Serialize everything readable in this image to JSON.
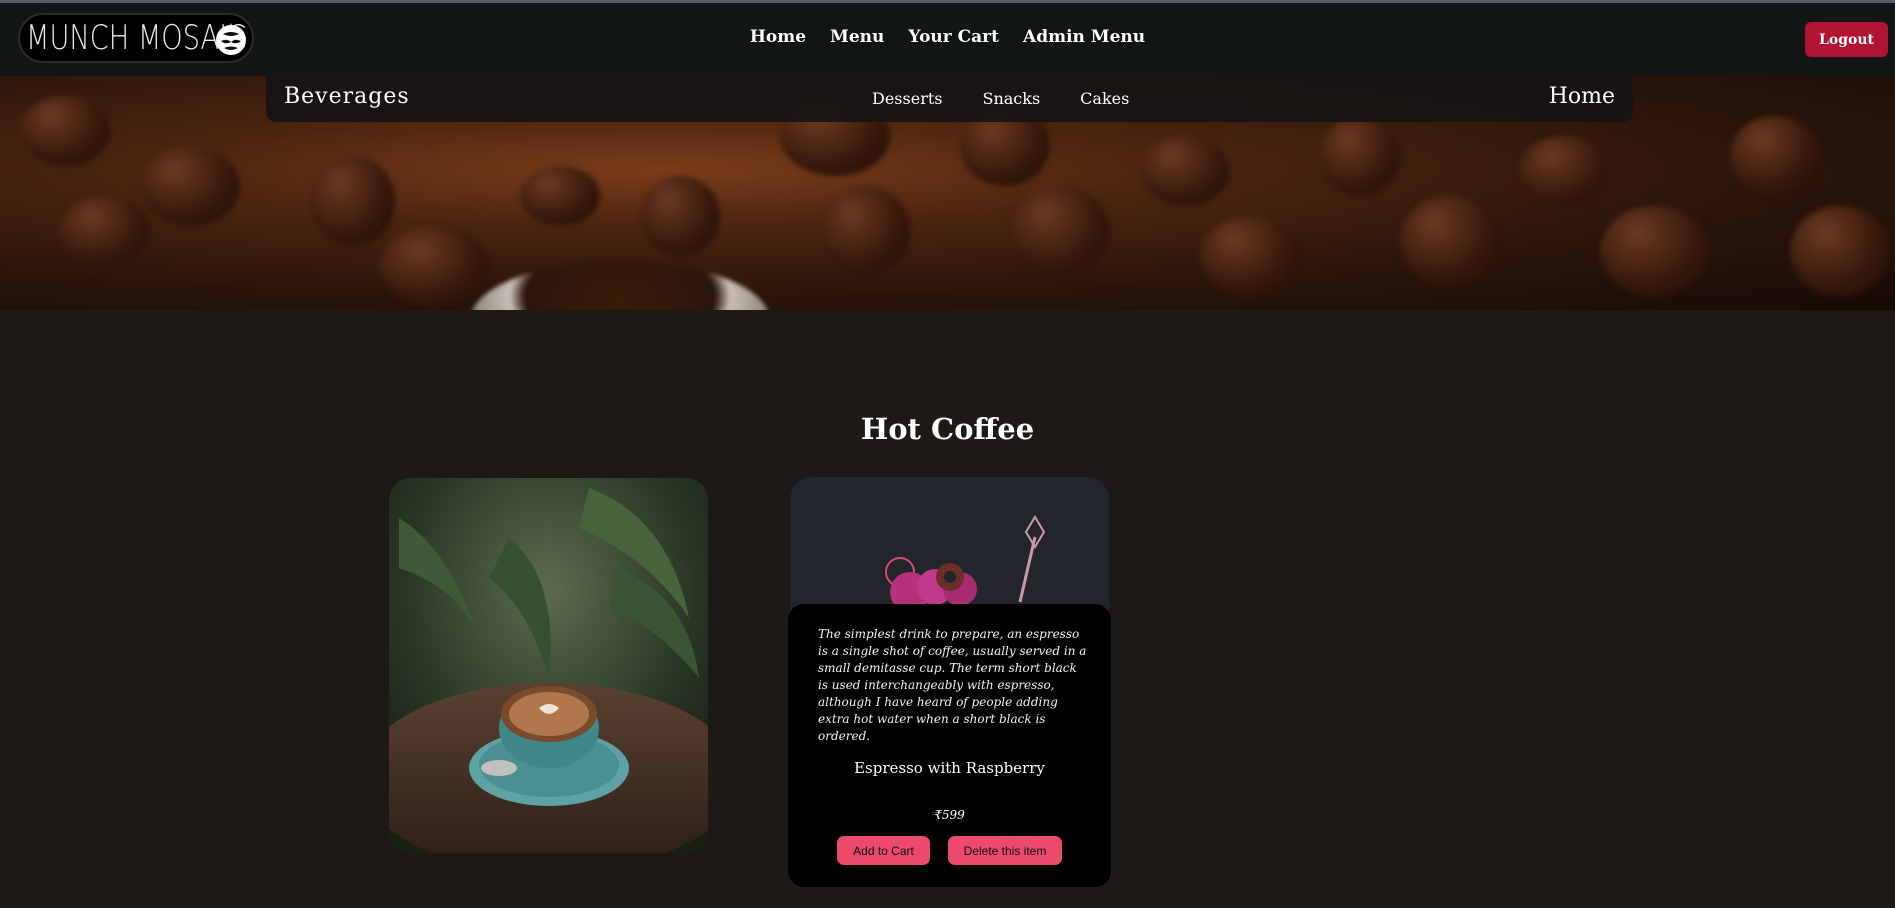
{
  "header": {
    "logo_text": "MUNCH MOSAIC",
    "logo_icon": "hop-icon",
    "nav": [
      "Home",
      "Menu",
      "Your Cart",
      "Admin Menu"
    ],
    "logout_label": "Logout"
  },
  "subnav": {
    "brand": "Beverages",
    "links": [
      "Desserts",
      "Snacks",
      "Cakes"
    ],
    "home": "Home"
  },
  "section": {
    "title": "Hot Coffee"
  },
  "product": {
    "description": "The simplest drink to prepare, an espresso is a single shot of coffee, usually served in a small demitasse cup. The term short black is used interchangeably with espresso, although I have heard of people adding extra hot water when a short black is ordered.",
    "name": "Espresso with Raspberry",
    "price": "₹599",
    "add_label": "Add to Cart",
    "delete_label": "Delete this item"
  },
  "colors": {
    "navbar_bg": "#111516",
    "page_bg": "#1d1916",
    "logout_bg": "#b11433",
    "button_bg": "#ec4a6a"
  }
}
